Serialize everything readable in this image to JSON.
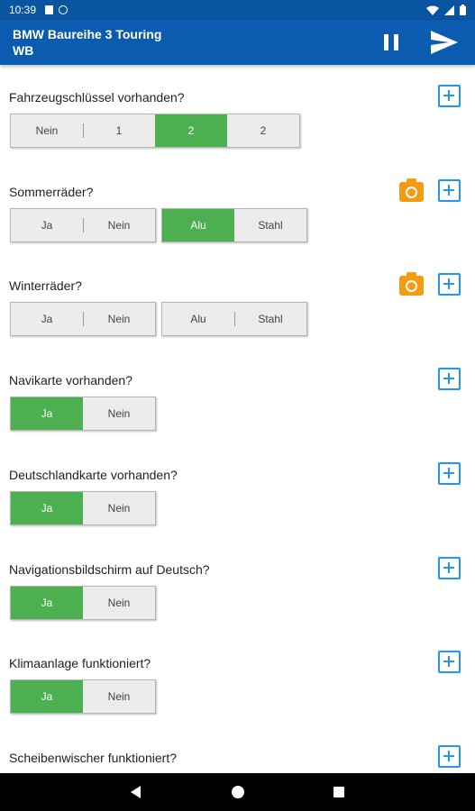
{
  "status_bar": {
    "time": "10:39"
  },
  "app_bar": {
    "title_line1": "BMW Baureihe 3 Touring",
    "title_line2": "WB",
    "actions": [
      "pause-icon",
      "send-icon"
    ]
  },
  "colors": {
    "app_bar": "#0b5bb0",
    "selected": "#4caf50",
    "add_icon": "#2196f3",
    "camera_icon": "#f39c12"
  },
  "questions": [
    {
      "label": "Fahrzeugschlüssel vorhanden?",
      "groups": [
        {
          "options": [
            {
              "label": "Nein",
              "selected": false
            },
            {
              "label": "1",
              "selected": false
            },
            {
              "label": "2",
              "selected": true
            },
            {
              "label": "2",
              "selected": false
            }
          ]
        }
      ]
    },
    {
      "label": "Sommerräder?",
      "camera": true,
      "groups": [
        {
          "options": [
            {
              "label": "Ja",
              "selected": false
            },
            {
              "label": "Nein",
              "selected": false
            }
          ]
        },
        {
          "options": [
            {
              "label": "Alu",
              "selected": true
            },
            {
              "label": "Stahl",
              "selected": false
            }
          ]
        }
      ]
    },
    {
      "label": "Winterräder?",
      "camera": true,
      "groups": [
        {
          "options": [
            {
              "label": "Ja",
              "selected": false
            },
            {
              "label": "Nein",
              "selected": false
            }
          ]
        },
        {
          "options": [
            {
              "label": "Alu",
              "selected": false
            },
            {
              "label": "Stahl",
              "selected": false
            }
          ]
        }
      ]
    },
    {
      "label": "Navikarte vorhanden?",
      "groups": [
        {
          "options": [
            {
              "label": "Ja",
              "selected": true
            },
            {
              "label": "Nein",
              "selected": false
            }
          ]
        }
      ]
    },
    {
      "label": "Deutschlandkarte vorhanden?",
      "groups": [
        {
          "options": [
            {
              "label": "Ja",
              "selected": true
            },
            {
              "label": "Nein",
              "selected": false
            }
          ]
        }
      ]
    },
    {
      "label": "Navigationsbildschirm auf Deutsch?",
      "groups": [
        {
          "options": [
            {
              "label": "Ja",
              "selected": true
            },
            {
              "label": "Nein",
              "selected": false
            }
          ]
        }
      ]
    },
    {
      "label": "Klimaanlage funktioniert?",
      "groups": [
        {
          "options": [
            {
              "label": "Ja",
              "selected": true
            },
            {
              "label": "Nein",
              "selected": false
            }
          ]
        }
      ]
    },
    {
      "label": "Scheibenwischer funktioniert?",
      "groups": []
    }
  ],
  "nav_bar": [
    "back-icon",
    "home-icon",
    "recents-icon"
  ]
}
